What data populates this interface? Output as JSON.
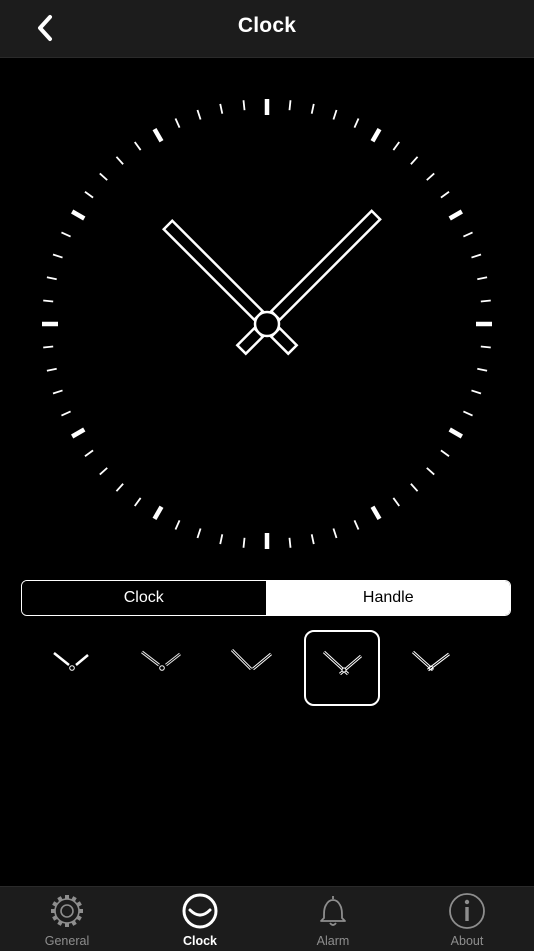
{
  "nav": {
    "title": "Clock",
    "back_icon": "chevron-left-icon"
  },
  "clock": {
    "hour": 10,
    "minute": 8,
    "tick_color": "#ffffff",
    "face_color": "#000000"
  },
  "segment": {
    "options": [
      "Clock",
      "Handle"
    ],
    "selected": "Handle"
  },
  "hand_styles": {
    "count": 5,
    "selected_index": 3
  },
  "tabs": [
    {
      "label": "General",
      "icon": "gear-icon",
      "active": false
    },
    {
      "label": "Clock",
      "icon": "clock-icon",
      "active": true
    },
    {
      "label": "Alarm",
      "icon": "bell-icon",
      "active": false
    },
    {
      "label": "About",
      "icon": "info-icon",
      "active": false
    }
  ],
  "colors": {
    "bar_bg": "#1c1c1c",
    "inactive_tab": "#8e8e8e",
    "active": "#ffffff"
  }
}
